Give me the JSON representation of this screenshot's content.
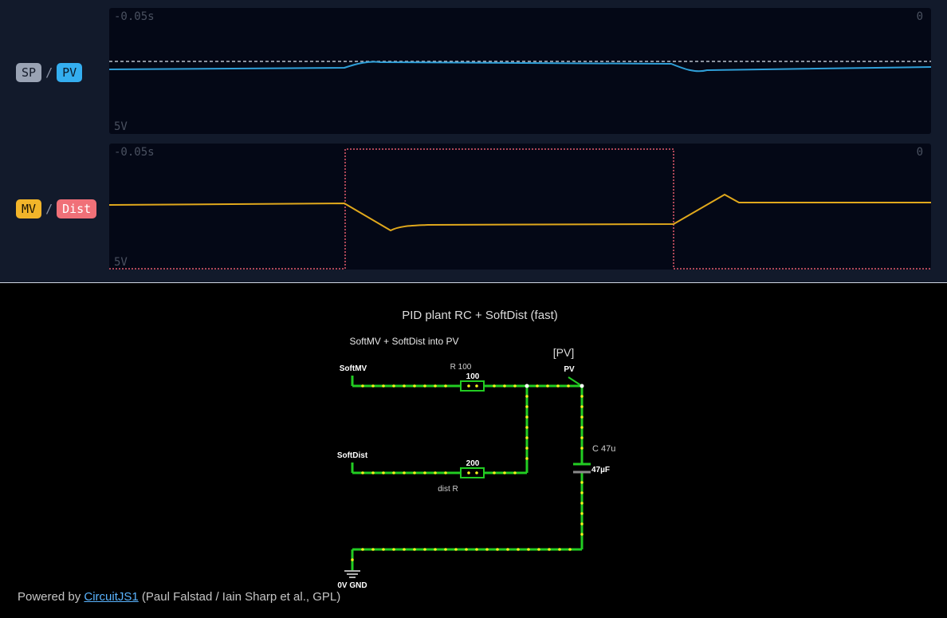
{
  "colors": {
    "sp": "#b8bfcc",
    "pv": "#2f9fd8",
    "mv": "#e0a81c",
    "dist": "#e45a6d",
    "chip_sp": "#9aa3b4",
    "chip_pv": "#34aef0",
    "chip_mv": "#f2b52a",
    "chip_dist": "#f07078",
    "wire": "#22cc22",
    "current_dot": "#f2f21a",
    "label": "#ffffff"
  },
  "scope1": {
    "legend": {
      "a": "SP",
      "sep": "/",
      "b": "PV"
    },
    "time_left": "-0.05s",
    "time_right": "0",
    "volt": "5V"
  },
  "scope2": {
    "legend": {
      "a": "MV",
      "sep": "/",
      "b": "Dist"
    },
    "time_left": "-0.05s",
    "time_right": "0",
    "volt": "5V"
  },
  "circuit": {
    "title": "PID plant RC + SoftDist (fast)",
    "subtitle": "SoftMV + SoftDist into PV",
    "pv_tag": "[PV]",
    "pv_label": "PV",
    "softmv_label": "SoftMV",
    "softdist_label": "SoftDist",
    "r1_name": "R 100",
    "r1_value": "100",
    "r2_value": "200",
    "r2_name": "dist R",
    "c_name": "C 47u",
    "c_value": "47µF",
    "gnd_label": "0V GND"
  },
  "footer": {
    "prefix": "Powered by",
    "link": "CircuitJS1",
    "suffix": "(Paul Falstad / Iain Sharp et al., GPL)"
  }
}
